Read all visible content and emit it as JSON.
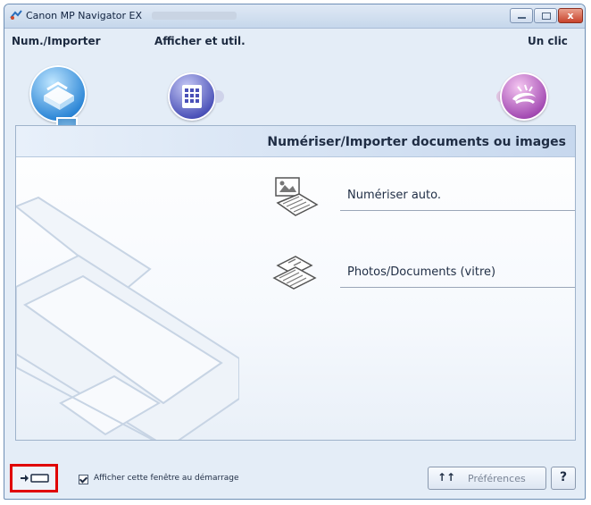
{
  "window": {
    "title": "Canon MP Navigator EX",
    "controls": [
      "minimize",
      "maximize",
      "close"
    ],
    "close_glyph": "x"
  },
  "tabs": [
    {
      "label": "Num./Importer",
      "icon": "scanner-icon",
      "selected": true
    },
    {
      "label": "Afficher et util.",
      "icon": "grid-view-icon",
      "selected": false
    },
    {
      "label": "Un clic",
      "icon": "one-click-icon",
      "selected": false
    }
  ],
  "panel": {
    "title": "Numériser/Importer documents ou images",
    "options": [
      {
        "label": "Numériser auto.",
        "icon": "auto-scan-icon"
      },
      {
        "label": "Photos/Documents (vitre)",
        "icon": "platen-documents-icon"
      }
    ]
  },
  "footer": {
    "startup_checkbox_label": "Afficher cette fenêtre au démarrage",
    "startup_checkbox_checked": true,
    "preferences_icon": "↑↑",
    "preferences_label": "Préférences",
    "help_label": "?"
  },
  "colors": {
    "highlight": "#e00000",
    "accent_blue": "#2c86d6",
    "accent_indigo": "#4b51b8",
    "accent_purple": "#a34ab2"
  }
}
